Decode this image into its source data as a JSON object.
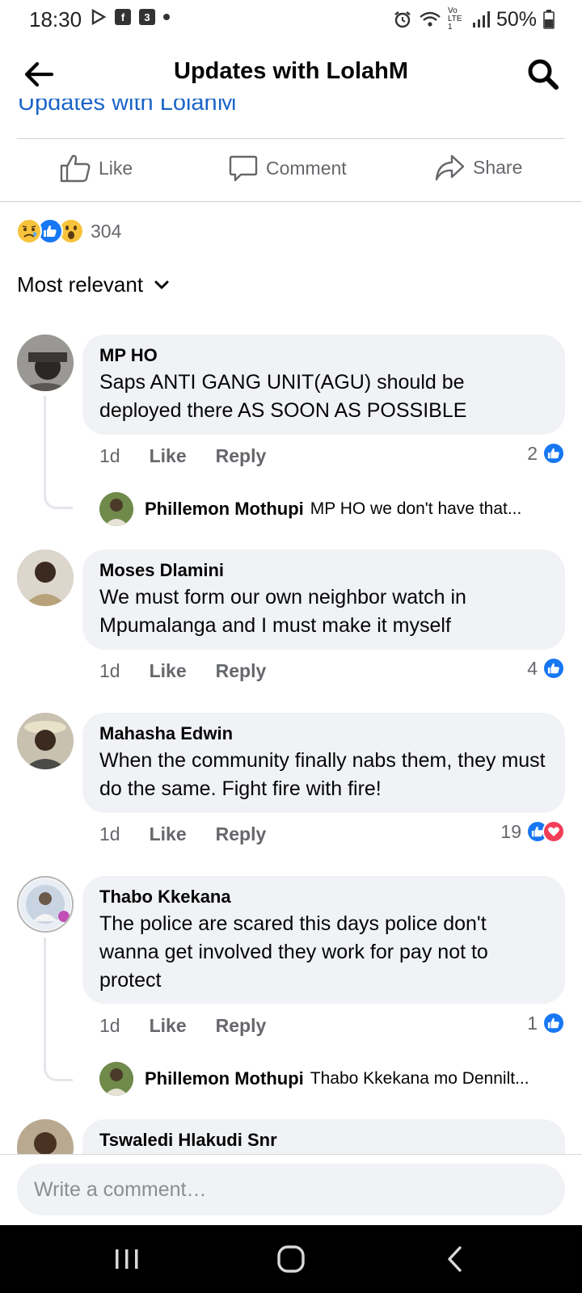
{
  "status_bar": {
    "time": "18:30",
    "battery": "50%",
    "network": "Vo LTE1"
  },
  "header": {
    "title": "Updates with LolahM"
  },
  "post": {
    "scrolled_title": "Updates with LolahM",
    "actions": {
      "like": "Like",
      "comment": "Comment",
      "share": "Share"
    },
    "reaction_count": "304",
    "reaction_types": [
      "sad",
      "like",
      "wow"
    ]
  },
  "sort": {
    "label": "Most relevant"
  },
  "comments": [
    {
      "author": "MP HO",
      "text": "Saps ANTI GANG UNIT(AGU) should be deployed there AS SOON AS POSSIBLE",
      "age": "1d",
      "like_label": "Like",
      "reply_label": "Reply",
      "reaction_count": "2",
      "reactions": [
        "like"
      ],
      "reply": {
        "author": "Phillemon Mothupi",
        "text": "MP HO we don't have that..."
      }
    },
    {
      "author": "Moses Dlamini",
      "text": "We must form our own neighbor watch in Mpumalanga and I must make it myself",
      "age": "1d",
      "like_label": "Like",
      "reply_label": "Reply",
      "reaction_count": "4",
      "reactions": [
        "like"
      ]
    },
    {
      "author": "Mahasha Edwin",
      "text": "When the community finally nabs them, they must do the same. Fight fire with fire!",
      "age": "1d",
      "like_label": "Like",
      "reply_label": "Reply",
      "reaction_count": "19",
      "reactions": [
        "like",
        "love"
      ]
    },
    {
      "author": "Thabo Kkekana",
      "text": "The police are scared this days police don't wanna get involved they work for pay not to protect",
      "age": "1d",
      "like_label": "Like",
      "reply_label": "Reply",
      "reaction_count": "1",
      "reactions": [
        "like"
      ],
      "reply": {
        "author": "Phillemon Mothupi",
        "text": "Thabo Kkekana mo Dennilt..."
      }
    },
    {
      "author": "Tswaledi Hlakudi Snr"
    }
  ],
  "composer": {
    "placeholder": "Write a comment…"
  },
  "colors": {
    "accent": "#1877f2",
    "link": "#1b64c8",
    "love": "#f33e58",
    "bubble": "#f0f2f5",
    "meta": "#65676b"
  }
}
